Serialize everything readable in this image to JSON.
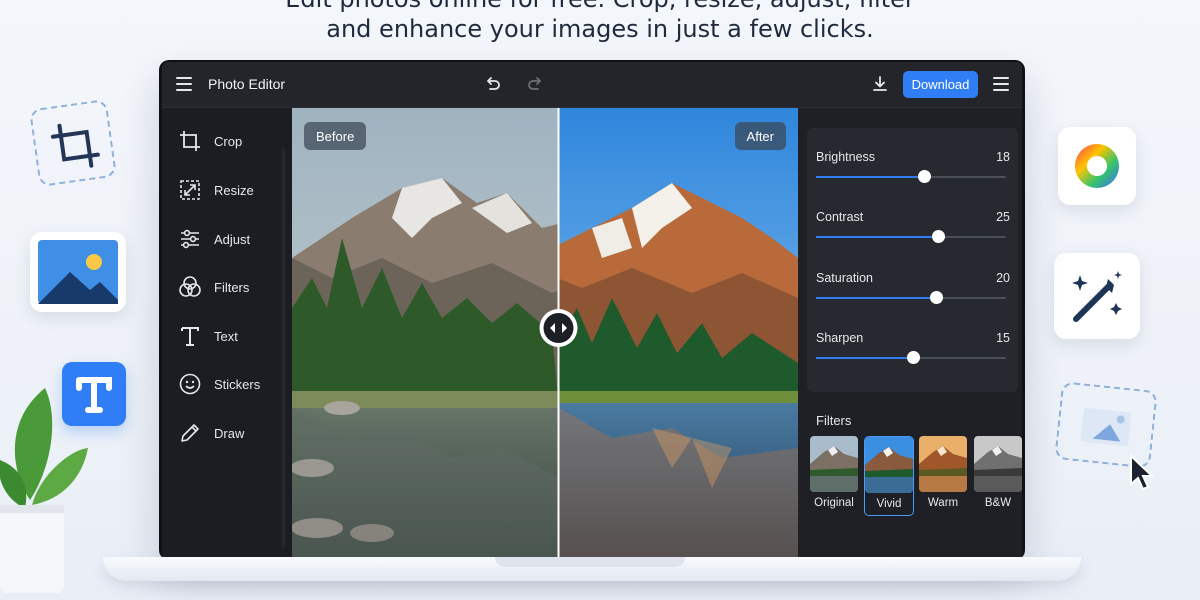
{
  "headline": {
    "line1": "Edit photos online for free. Crop, resize, adjust, filter",
    "line2": "and enhance your images in just a few clicks."
  },
  "topbar": {
    "title": "Photo Editor",
    "download_label": "Download",
    "icons": [
      "menu-icon",
      "undo-icon",
      "redo-icon",
      "download-icon",
      "menu-icon"
    ]
  },
  "sidebar": {
    "items": [
      {
        "label": "Crop",
        "icon": "crop-icon"
      },
      {
        "label": "Resize",
        "icon": "resize-icon"
      },
      {
        "label": "Adjust",
        "icon": "sliders-icon"
      },
      {
        "label": "Filters",
        "icon": "filters-icon"
      },
      {
        "label": "Text",
        "icon": "text-icon"
      },
      {
        "label": "Stickers",
        "icon": "smiley-icon"
      },
      {
        "label": "Draw",
        "icon": "pencil-icon"
      }
    ]
  },
  "canvas": {
    "before_label": "Before",
    "after_label": "After",
    "split_handle_icon": "split-arrows-icon"
  },
  "adjustments": [
    {
      "name": "Brightness",
      "value": "18",
      "level": 0.57
    },
    {
      "name": "Contrast",
      "value": "25",
      "level": 0.64
    },
    {
      "name": "Saturation",
      "value": "20",
      "level": 0.63
    },
    {
      "name": "Sharpen",
      "value": "15",
      "level": 0.51
    }
  ],
  "filters": {
    "title": "Filters",
    "items": [
      {
        "name": "Original",
        "selected": false
      },
      {
        "name": "Vivid",
        "selected": true
      },
      {
        "name": "Warm",
        "selected": false
      },
      {
        "name": "B&W",
        "selected": false
      }
    ]
  },
  "colors": {
    "accent": "#2f7ef6",
    "app_bg": "#1e2026",
    "topbar_bg": "#23252b"
  }
}
